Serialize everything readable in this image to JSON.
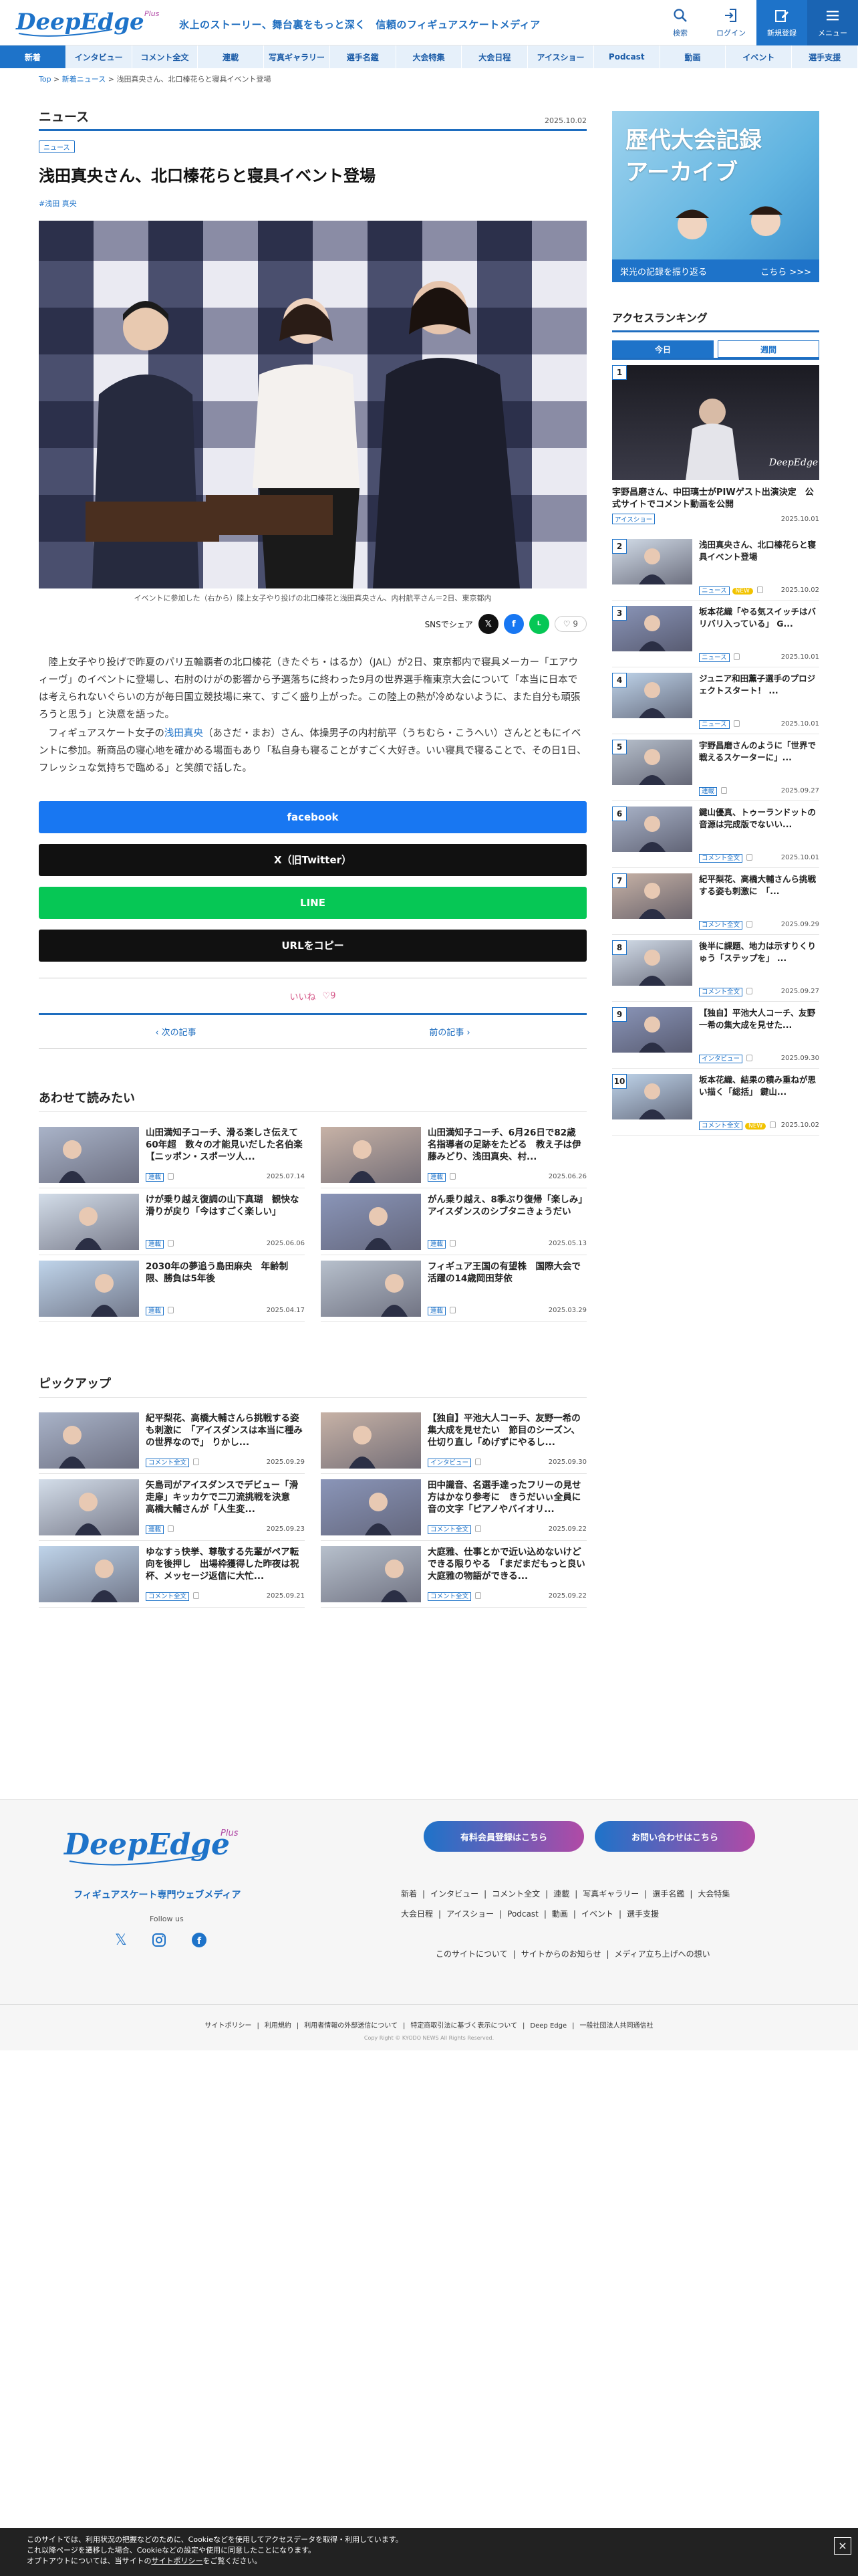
{
  "header": {
    "logo_text": "DeepEdge",
    "logo_plus": "Plus",
    "tagline": "氷上のストーリー、舞台裏をもっと深く　信頼のフィギュアスケートメディア",
    "icons": [
      {
        "label": "検索"
      },
      {
        "label": "ログイン"
      },
      {
        "label": "新規登録"
      },
      {
        "label": "メニュー"
      }
    ]
  },
  "nav": [
    "新着",
    "インタビュー",
    "コメント全文",
    "連載",
    "写真ギャラリー",
    "選手名鑑",
    "大会特集",
    "大会日程",
    "アイスショー",
    "Podcast",
    "動画",
    "イベント",
    "選手支援"
  ],
  "breadcrumb": {
    "top": "Top",
    "sep": " > ",
    "news": "新着ニュース",
    "current": "浅田真央さん、北口榛花らと寝具イベント登場"
  },
  "article": {
    "section": "ニュース",
    "date": "2025.10.02",
    "tag": "ニュース",
    "title": "浅田真央さん、北口榛花らと寝具イベント登場",
    "hashtag": "#浅田 真央",
    "caption": "イベントに参加した（右から）陸上女子やり投げの北口榛花と浅田真央さん、内村航平さん＝2日、東京都内",
    "share_label": "SNSでシェア",
    "like_count": "9",
    "p1": "陸上女子やり投げで昨夏のパリ五輪覇者の北口榛花（きたぐち・はるか）（JAL）が2日、東京都内で寝具メーカー「エアウィーヴ」のイベントに登場し、右肘のけがの影響から予選落ちに終わった9月の世界選手権東京大会について「本当に日本では考えられないぐらいの方が毎日国立競技場に来て、すごく盛り上がった。この陸上の熱が冷めないように、また自分も頑張ろうと思う」と決意を語った。",
    "p2_pre": "フィギュアスケート女子の",
    "p2_link": "浅田真央",
    "p2_post": "（あさだ・まお）さん、体操男子の内村航平（うちむら・こうへい）さんとともにイベントに参加。新商品の寝心地を確かめる場面もあり「私自身も寝ることがすごく大好き。いい寝具で寝ることで、その日1日、フレッシュな気持ちで臨める」と笑顔で話した。",
    "btn_facebook": "facebook",
    "btn_x": "X（旧Twitter）",
    "btn_line": "LINE",
    "btn_copy": "URLをコピー",
    "like_label": "いいね",
    "next": "次の記事",
    "prev": "前の記事"
  },
  "related": {
    "title": "あわせて読みたい",
    "items": [
      {
        "title": "山田満知子コーチ、滑る楽しさ伝えて60年超　数々の才能見いだした名伯楽　【ニッポン・スポーツ人...",
        "badge": "連載",
        "date": "2025.07.14"
      },
      {
        "title": "山田満知子コーチ、6月26日で82歳　名指導者の足跡をたどる　教え子は伊藤みどり、浅田真央、村...",
        "badge": "連載",
        "date": "2025.06.26"
      },
      {
        "title": "けが乗り越え復調の山下真瑚　観快な滑りが戻り「今はすごく楽しい」",
        "badge": "連載",
        "date": "2025.06.06"
      },
      {
        "title": "がん乗り越え、8季ぶり復帰「楽しみ」　アイスダンスのシブタニきょうだい",
        "badge": "連載",
        "date": "2025.05.13"
      },
      {
        "title": "2030年の夢追う島田麻央　年齢制限、勝負は5年後",
        "badge": "連載",
        "date": "2025.04.17"
      },
      {
        "title": "フィギュア王国の有望株　国際大会で活躍の14歳岡田芽依",
        "badge": "連載",
        "date": "2025.03.29"
      }
    ]
  },
  "pickup": {
    "title": "ピックアップ",
    "items": [
      {
        "title": "紀平梨花、高橋大輔さんら挑戦する姿も刺激に　「アイスダンスは本当に種みの世界なので」 りかし...",
        "badge": "コメント全文",
        "date": "2025.09.29"
      },
      {
        "title": "【独自】平池大人コーチ、友野一希の集大成を見せたい　節目のシーズン、仕切り直し「めげずにやるし...",
        "badge": "インタビュー",
        "date": "2025.09.30"
      },
      {
        "title": "矢島司がアイスダンスでデビュー「滑走扉」キッカケで二刀流挑戦を決意　高橋大輔さんが「人生変...",
        "badge": "連載",
        "date": "2025.09.23"
      },
      {
        "title": "田中識音、名選手達ったフリーの見せ方はかなり参考に　きうだいぃ全員に音の文字「ピアノやバイオリ...",
        "badge": "コメント全文",
        "date": "2025.09.22"
      },
      {
        "title": "ゆなすぅ快挙、尊敬する先輩がペア転向を後押し　出場枠獲得した昨夜は祝杯、メッセージ返信に大忙...",
        "badge": "コメント全文",
        "date": "2025.09.21"
      },
      {
        "title": "大庭雅、仕事とかで近い込めないけどできる限りやる　「まだまだもっと良い大庭雅の物語ができる...",
        "badge": "コメント全文",
        "date": "2025.09.22"
      }
    ]
  },
  "sidebar": {
    "banner_line1": "歴代大会記録",
    "banner_line2": "アーカイブ",
    "banner_sub": "栄光の記録を振り返る",
    "banner_more": "こちら >>>",
    "ranking_title": "アクセスランキング",
    "tab_today": "今日",
    "tab_week": "週間",
    "rank1": {
      "num": "1",
      "title": "宇野昌磨さん、中田璃士がPIWゲスト出演決定　公式サイトでコメント動画を公開",
      "badge": "アイスショー",
      "date": "2025.10.01"
    },
    "ranks": [
      {
        "num": "2",
        "title": "浅田真央さん、北口榛花らと寝具イベント登場",
        "badge": "ニュース",
        "new": "NEW",
        "date": "2025.10.02"
      },
      {
        "num": "3",
        "title": "坂本花織「やる気スイッチはバリバリ入っている」 G...",
        "badge": "ニュース",
        "date": "2025.10.01"
      },
      {
        "num": "4",
        "title": "ジュニア和田薫子選手のプロジェクトスタート！ ...",
        "badge": "ニュース",
        "date": "2025.10.01"
      },
      {
        "num": "5",
        "title": "宇野昌磨さんのように「世界で戦えるスケーターに」...",
        "badge": "連載",
        "date": "2025.09.27"
      },
      {
        "num": "6",
        "title": "鍵山優真、トゥーランドットの音源は完成版でないい...",
        "badge": "コメント全文",
        "date": "2025.10.01"
      },
      {
        "num": "7",
        "title": "紀平梨花、高橋大輔さんら挑戦する姿も刺激に　「...",
        "badge": "コメント全文",
        "date": "2025.09.29"
      },
      {
        "num": "8",
        "title": "後半に課題、地力は示すりくりゅう「ステップを」 ...",
        "badge": "コメント全文",
        "date": "2025.09.27"
      },
      {
        "num": "9",
        "title": "【独自】平池大人コーチ、友野一希の集大成を見せた...",
        "badge": "インタビュー",
        "date": "2025.09.30"
      },
      {
        "num": "10",
        "title": "坂本花織、結果の積み重ねが思い描く「総括」 鍵山...",
        "badge": "コメント全文",
        "new": "NEW",
        "date": "2025.10.02"
      }
    ]
  },
  "footer": {
    "logo_text": "DeepEdge",
    "logo_plus": "Plus",
    "sub": "フィギュアスケート専門ウェブメディア",
    "follow": "Follow us",
    "btn_member": "有料会員登録はこちら",
    "btn_contact": "お問い合わせはこちら",
    "links1": [
      "新着",
      "インタビュー",
      "コメント全文",
      "連載",
      "写真ギャラリー",
      "選手名鑑",
      "大会特集"
    ],
    "links1b": [
      "大会日程",
      "アイスショー",
      "Podcast",
      "動画",
      "イベント",
      "選手支援"
    ],
    "links2": [
      "このサイトについて",
      "サイトからのお知らせ",
      "メディア立ち上げへの想い"
    ],
    "bottom": [
      "サイトポリシー",
      "利用規約",
      "利用者情報の外部送信について",
      "特定商取引法に基づく表示について",
      "Deep Edge",
      "一般社団法人共同通信社"
    ],
    "copy": "Copy Right © KYODO NEWS All Rights Reserved."
  },
  "cookie": {
    "line1": "このサイトでは、利用状況の把握などのために、Cookieなどを使用してアクセスデータを取得・利用しています。",
    "line2": "これ以降ページを遷移した場合、Cookieなどの設定や使用に同意したことになります。",
    "line3_pre": "オプトアウトについては、当サイトの",
    "line3_link": "サイトポリシー",
    "line3_post": "をご覧ください。",
    "close": "×"
  },
  "colors": {
    "accent": "#1e73c9",
    "facebook": "#1877f2",
    "x": "#111111",
    "line": "#06c755"
  }
}
